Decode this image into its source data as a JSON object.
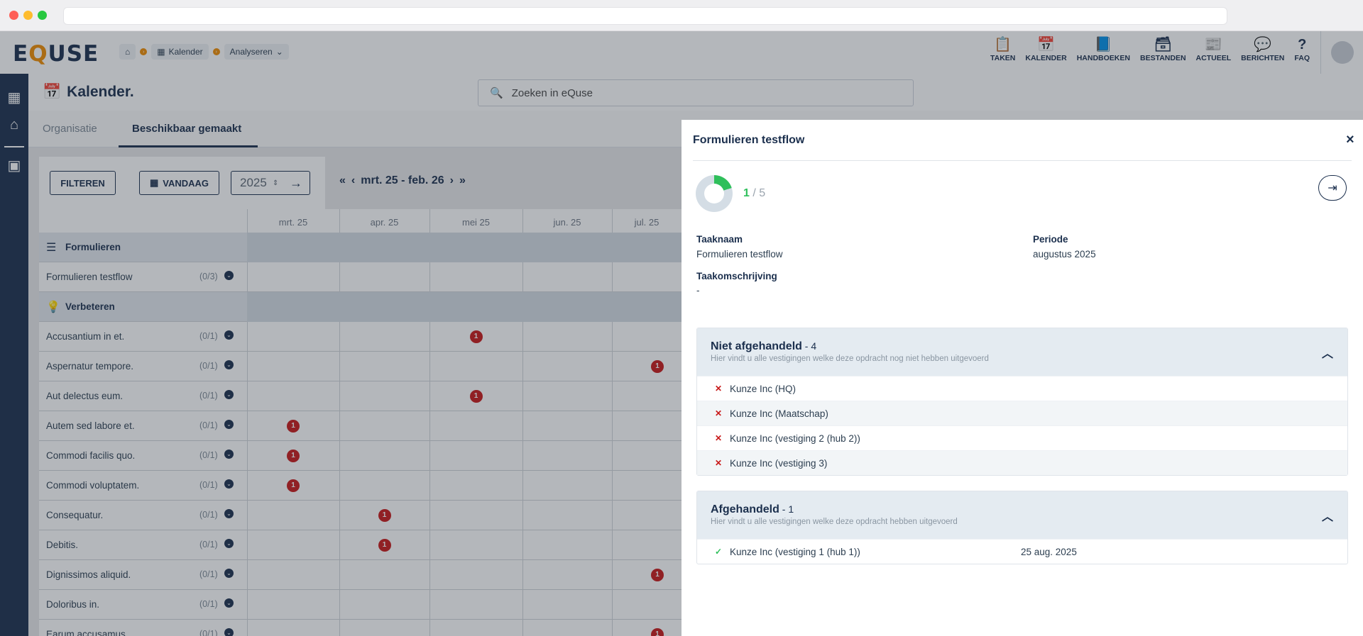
{
  "app": {
    "logo_pre": "E",
    "logo_q": "Q",
    "logo_post": "USE"
  },
  "breadcrumbs": [
    {
      "label": ""
    },
    {
      "label": "Kalender"
    },
    {
      "label": "Analyseren"
    }
  ],
  "topnav": [
    {
      "label": "TAKEN",
      "icon": "clipboard-icon"
    },
    {
      "label": "KALENDER",
      "icon": "calendar-icon"
    },
    {
      "label": "HANDBOEKEN",
      "icon": "book-icon"
    },
    {
      "label": "BESTANDEN",
      "icon": "archive-icon"
    },
    {
      "label": "ACTUEEL",
      "icon": "news-icon"
    },
    {
      "label": "BERICHTEN",
      "icon": "chat-icon"
    },
    {
      "label": "FAQ",
      "icon": "question-icon"
    }
  ],
  "page": {
    "title": "Kalender."
  },
  "search": {
    "placeholder": "Zoeken in eQuse"
  },
  "tabs": [
    {
      "label": "Organisatie"
    },
    {
      "label": "Beschikbaar gemaakt"
    }
  ],
  "toolbar": {
    "filter_label": "FILTEREN",
    "today_label": "VANDAAG",
    "year": "2025",
    "period": "mrt. 25 - feb. 26"
  },
  "months": [
    "mrt. 25",
    "apr. 25",
    "mei 25",
    "jun. 25",
    "jul. 25"
  ],
  "rows": [
    {
      "label": "Formulieren",
      "section": true
    },
    {
      "label": "Formulieren testflow",
      "count": "(0/3)"
    },
    {
      "label": "Verbeteren",
      "section": true
    },
    {
      "label": "Accusantium in et.",
      "count": "(0/1)",
      "badge_month": 2,
      "badge": "1"
    },
    {
      "label": "Aspernatur tempore.",
      "count": "(0/1)",
      "badge_month": 4,
      "badge": "1"
    },
    {
      "label": "Aut delectus eum.",
      "count": "(0/1)",
      "badge_month": 2,
      "badge": "1"
    },
    {
      "label": "Autem sed labore et.",
      "count": "(0/1)",
      "badge_month": 0,
      "badge": "1"
    },
    {
      "label": "Commodi facilis quo.",
      "count": "(0/1)",
      "badge_month": 0,
      "badge": "1"
    },
    {
      "label": "Commodi voluptatem.",
      "count": "(0/1)",
      "badge_month": 0,
      "badge": "1"
    },
    {
      "label": "Consequatur.",
      "count": "(0/1)",
      "badge_month": 1,
      "badge": "1"
    },
    {
      "label": "Debitis.",
      "count": "(0/1)",
      "badge_month": 1,
      "badge": "1"
    },
    {
      "label": "Dignissimos aliquid.",
      "count": "(0/1)",
      "badge_month": 4,
      "badge": "1"
    },
    {
      "label": "Doloribus in.",
      "count": "(0/1)"
    },
    {
      "label": "Earum accusamus.",
      "count": "(0/1)",
      "badge_month": 4,
      "badge": "1"
    }
  ],
  "panel": {
    "title": "Formulieren testflow",
    "score_done": "1",
    "score_total": " / 5",
    "progress_fraction": 0.2,
    "taaknaam_label": "Taaknaam",
    "taaknaam": "Formulieren testflow",
    "periode_label": "Periode",
    "periode": "augustus 2025",
    "omschrijving_label": "Taakomschrijving",
    "omschrijving": "-",
    "open": {
      "title": "Niet afgehandeld",
      "count": " - 4",
      "subtitle": "Hier vindt u alle vestigingen welke deze opdracht nog niet hebben uitgevoerd",
      "items": [
        "Kunze Inc (HQ)",
        "Kunze Inc (Maatschap)",
        "Kunze Inc (vestiging 2 (hub 2))",
        "Kunze Inc (vestiging 3)"
      ]
    },
    "done": {
      "title": "Afgehandeld",
      "count": " - 1",
      "subtitle": "Hier vindt u alle vestigingen welke deze opdracht hebben uitgevoerd",
      "items": [
        {
          "name": "Kunze Inc (vestiging 1 (hub 1))",
          "date": "25 aug. 2025"
        }
      ]
    }
  },
  "colors": {
    "navy": "#1b2f4d",
    "accent": "#f08c00",
    "badge": "#c81818",
    "success": "#2fbf5b"
  }
}
